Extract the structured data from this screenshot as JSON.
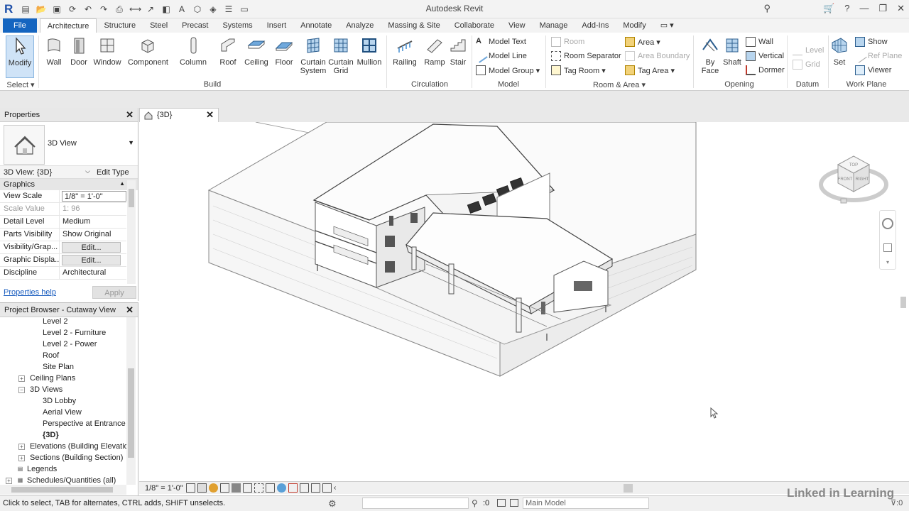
{
  "app": {
    "title": "Autodesk Revit"
  },
  "tabs": [
    "File",
    "Architecture",
    "Structure",
    "Steel",
    "Precast",
    "Systems",
    "Insert",
    "Annotate",
    "Analyze",
    "Massing & Site",
    "Collaborate",
    "View",
    "Manage",
    "Add-Ins",
    "Modify"
  ],
  "ribbon": {
    "select": {
      "modify": "Modify",
      "group": "Select ▾"
    },
    "build": {
      "wall": "Wall",
      "door": "Door",
      "window": "Window",
      "component": "Component",
      "column": "Column",
      "roof": "Roof",
      "ceiling": "Ceiling",
      "floor": "Floor",
      "curtain_system_1": "Curtain",
      "curtain_system_2": "System",
      "curtain_grid_1": "Curtain",
      "curtain_grid_2": "Grid",
      "mullion": "Mullion",
      "group": "Build"
    },
    "circulation": {
      "railing": "Railing",
      "ramp": "Ramp",
      "stair": "Stair",
      "group": "Circulation"
    },
    "model": {
      "text": "Model  Text",
      "line": "Model  Line",
      "group_btn": "Model  Group ▾",
      "group": "Model"
    },
    "room_area": {
      "room": "Room",
      "separator": "Room  Separator",
      "tag_room": "Tag  Room ▾",
      "area": "Area ▾",
      "area_boundary": "Area  Boundary",
      "tag_area": "Tag  Area ▾",
      "group": "Room & Area ▾"
    },
    "opening": {
      "by_face_1": "By",
      "by_face_2": "Face",
      "shaft": "Shaft",
      "wall": "Wall",
      "vertical": "Vertical",
      "dormer": "Dormer",
      "group": "Opening"
    },
    "datum": {
      "level": "Level",
      "grid": "Grid",
      "group": "Datum"
    },
    "work_plane": {
      "set": "Set",
      "show": "Show",
      "ref_plane": "Ref  Plane",
      "viewer": "Viewer",
      "group": "Work Plane"
    }
  },
  "properties": {
    "title": "Properties",
    "type_name": "3D View",
    "instance": "3D View: {3D}",
    "edit_type": "Edit Type",
    "section": "Graphics",
    "rows": [
      {
        "key": "View Scale",
        "value": "1/8\" = 1'-0\""
      },
      {
        "key": "Scale Value",
        "value": "1:  96"
      },
      {
        "key": "Detail Level",
        "value": "Medium"
      },
      {
        "key": "Parts Visibility",
        "value": "Show Original"
      },
      {
        "key": "Visibility/Grap...",
        "value": "Edit..."
      },
      {
        "key": "Graphic Displa...",
        "value": "Edit..."
      },
      {
        "key": "Discipline",
        "value": "Architectural"
      }
    ],
    "help": "Properties help",
    "apply": "Apply"
  },
  "browser": {
    "title": "Project Browser - Cutaway View",
    "items": [
      "Level 2",
      "Level 2 - Furniture",
      "Level 2 - Power",
      "Roof",
      "Site Plan",
      "Ceiling Plans",
      "3D Views",
      "3D Lobby",
      "Aerial View",
      "Perspective at Entrance",
      "{3D}",
      "Elevations (Building Elevation",
      "Sections (Building Section)",
      "Legends",
      "Schedules/Quantities (all)"
    ]
  },
  "view": {
    "tab": "{3D}",
    "scale": "1/8\" = 1'-0\""
  },
  "status": {
    "message": "Click to select, TAB for alternates, CTRL adds, SHIFT unselects.",
    "zero": ":0",
    "model": "Main Model",
    "brand": "Linked in Learning"
  },
  "viewcube": {
    "top": "TOP",
    "front": "FRONT",
    "right": "RIGHT"
  },
  "colors": {
    "accent": "#1565c0",
    "active": "#cfe3f7"
  }
}
